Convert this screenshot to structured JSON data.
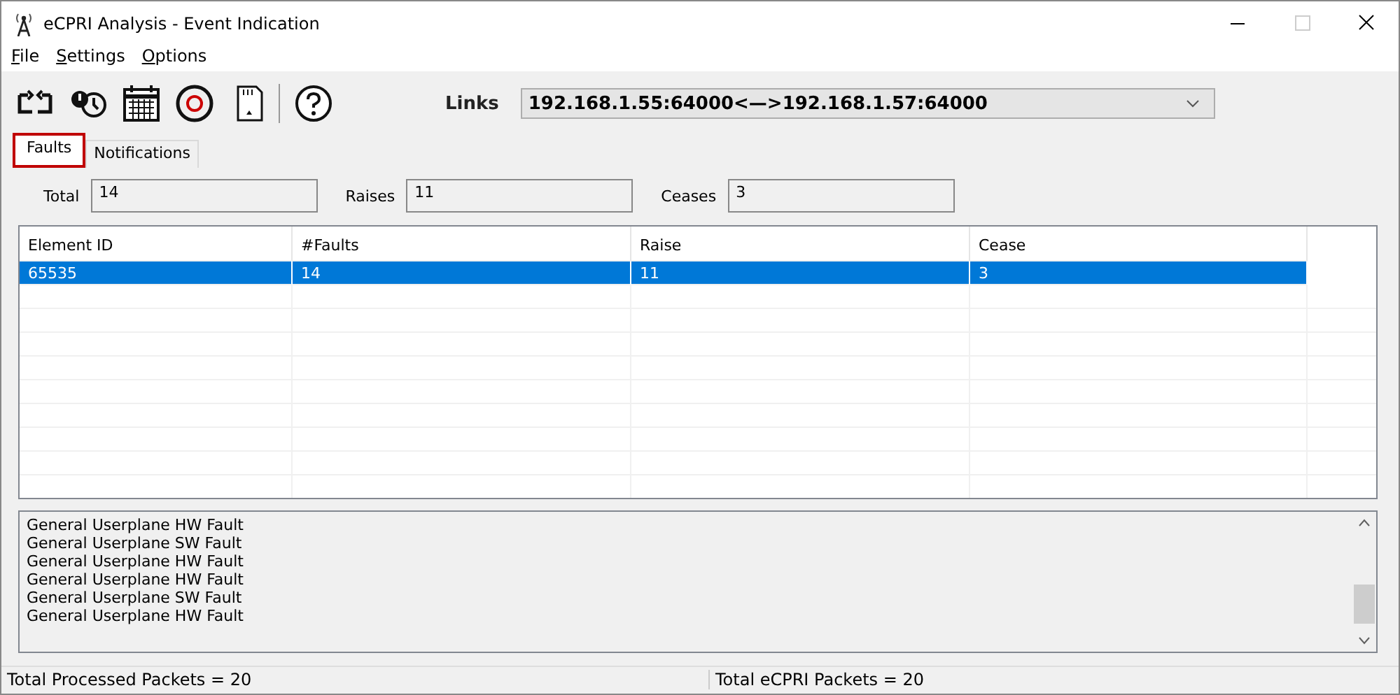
{
  "window": {
    "title": "eCPRI Analysis - Event Indication"
  },
  "menu": [
    {
      "label": "File"
    },
    {
      "label": "Settings"
    },
    {
      "label": "Options"
    }
  ],
  "links": {
    "label": "Links",
    "value": "192.168.1.55:64000<—>192.168.1.57:64000"
  },
  "tabs": [
    {
      "label": "Faults",
      "selected": true
    },
    {
      "label": "Notifications",
      "selected": false
    }
  ],
  "counts": [
    {
      "label": "Total",
      "value": "14"
    },
    {
      "label": "Raises",
      "value": "11"
    },
    {
      "label": "Ceases",
      "value": "3"
    }
  ],
  "table": {
    "columns": [
      "Element ID",
      "#Faults",
      "Raise",
      "Cease"
    ],
    "rows": [
      {
        "cells": [
          "65535",
          "14",
          "11",
          "3"
        ],
        "selected": true
      }
    ]
  },
  "log": [
    "General Userplane HW Fault",
    "General Userplane SW Fault",
    "General Userplane HW Fault",
    "General Userplane HW Fault",
    "General Userplane SW Fault",
    "General Userplane HW Fault"
  ],
  "status_bar": [
    "Total Processed Packets = 20",
    "Total eCPRI Packets = 20"
  ]
}
